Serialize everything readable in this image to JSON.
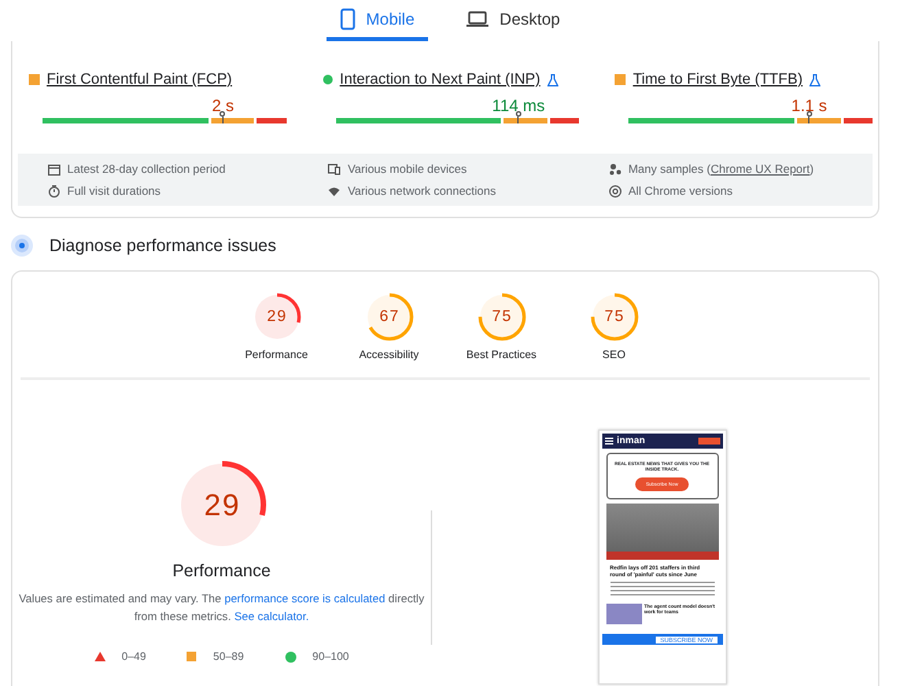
{
  "tabs": [
    {
      "label": "Mobile",
      "kind": "phone",
      "selected": true
    },
    {
      "label": "Desktop",
      "kind": "laptop",
      "selected": false
    }
  ],
  "metrics": [
    {
      "label": "First Contentful Paint (FCP)",
      "kind": "average",
      "experimental": false,
      "value": "2 s",
      "level": 0.74
    },
    {
      "label": "Interaction to Next Paint (INP)",
      "kind": "good",
      "experimental": true,
      "value": "114 ms",
      "level": 0.75
    },
    {
      "label": "Time to First Byte (TTFB)",
      "kind": "average",
      "experimental": true,
      "value": "1.1 s",
      "level": 0.74
    }
  ],
  "info": [
    {
      "kind": "calendar",
      "text": "Latest 28-day collection period"
    },
    {
      "kind": "devices",
      "text": "Various mobile devices"
    },
    {
      "kind": "samples",
      "text": "Many samples (",
      "link": "Chrome UX Report",
      "after": ")"
    },
    {
      "kind": "timer",
      "text": "Full visit durations"
    },
    {
      "kind": "wifi",
      "text": "Various network connections"
    },
    {
      "kind": "chrome",
      "text": "All Chrome versions"
    }
  ],
  "diagnose": {
    "title": "Diagnose performance issues"
  },
  "scores": [
    {
      "score": "29",
      "label": "Performance",
      "kind": "fail",
      "level": 0.29
    },
    {
      "score": "67",
      "label": "Accessibility",
      "kind": "average",
      "level": 0.67
    },
    {
      "score": "75",
      "label": "Best Practices",
      "kind": "average",
      "level": 0.75
    },
    {
      "score": "75",
      "label": "SEO",
      "kind": "average",
      "level": 0.75
    }
  ],
  "main": {
    "score": "29",
    "kind": "fail",
    "level": 0.29,
    "title": "Performance",
    "note": "Values are estimated and may vary. The ",
    "note_link": "performance score is calculated",
    "note_mid": " directly from these metrics. ",
    "calc_link": "See calculator."
  },
  "legend": [
    {
      "kind": "triangle",
      "label": "0–49"
    },
    {
      "kind": "square",
      "label": "50–89"
    },
    {
      "kind": "circle",
      "label": "90–100"
    }
  ],
  "thumbnail": {
    "logo": "inman",
    "tagline": "REAL ESTATE NEWS THAT GIVES YOU THE INSIDE TRACK.",
    "cta": "Subscribe Now",
    "headline": "Redfin lays off 201 staffers in third round of 'painful' cuts since June",
    "story": "The agent count model doesn't work for teams",
    "banner": "SUBSCRIBE NOW"
  }
}
